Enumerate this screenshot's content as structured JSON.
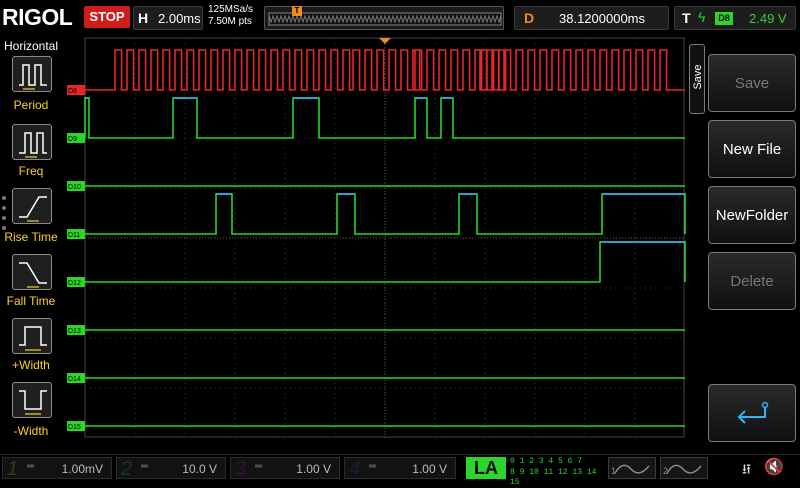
{
  "header": {
    "logo": "RIGOL",
    "run_state": "STOP",
    "h_label": "H",
    "timebase": "2.00ms",
    "sample_rate": "125MSa/s",
    "mem_depth": "7.50M pts",
    "trigger_marker": "T",
    "d_label": "D",
    "delay": "38.1200000ms",
    "t_label": "T",
    "trigger_source": "D8",
    "trigger_level": "2.49 V"
  },
  "left_panel": {
    "title": "Horizontal",
    "items": [
      {
        "label": "Period",
        "icon": "period-icon"
      },
      {
        "label": "Freq",
        "icon": "freq-icon"
      },
      {
        "label": "Rise Time",
        "icon": "rise-time-icon"
      },
      {
        "label": "Fall Time",
        "icon": "fall-time-icon"
      },
      {
        "label": "+Width",
        "icon": "positive-width-icon"
      },
      {
        "label": "-Width",
        "icon": "negative-width-icon"
      }
    ]
  },
  "right_panel": {
    "tab": "Save",
    "buttons": [
      {
        "label": "Save",
        "enabled": false
      },
      {
        "label": "New File",
        "enabled": true
      },
      {
        "label": "NewFolder",
        "enabled": true
      },
      {
        "label": "Delete",
        "enabled": false
      }
    ],
    "back_icon": "return-arrow-icon"
  },
  "channels": {
    "labels": [
      "D8",
      "D9",
      "D10",
      "D11",
      "D12",
      "D13",
      "D14",
      "D15"
    ],
    "d8_color": "#e8262c",
    "digital_color": "#29d729",
    "high_color": "#2ab6ff"
  },
  "bottom": {
    "ch1": {
      "num": "1",
      "volts": "1.00mV",
      "color": "#f2e82e"
    },
    "ch2": {
      "num": "2",
      "volts": "10.0 V",
      "color": "#1ad7e8"
    },
    "ch3": {
      "num": "3",
      "volts": "1.00 V",
      "color": "#e43ee4"
    },
    "ch4": {
      "num": "4",
      "volts": "1.00 V",
      "color": "#2b6ff2"
    },
    "la": "LA",
    "la_row1": "0 1 2 3   4 5 6 7",
    "la_row2": "8 9 10 11 12 13 14 15",
    "gen1": "1",
    "gen2": "2",
    "usb_icon": "usb-icon",
    "speaker_icon": "speaker-muted-icon"
  }
}
